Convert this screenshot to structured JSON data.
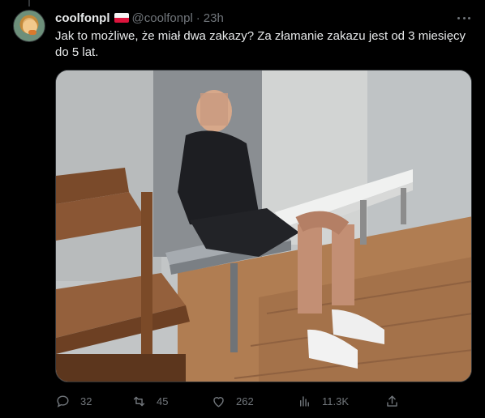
{
  "tweet": {
    "display_name": "coolfonpl",
    "flag": "Poland flag",
    "handle": "@coolfonpl",
    "separator": "·",
    "time": "23h",
    "text": "Jak to możliwe, że miał dwa zakazy? Za złamanie zakazu jest od 3 miesięcy do 5 lat."
  },
  "media": {
    "description_icon": "photo"
  },
  "actions": {
    "replies": "32",
    "reposts": "45",
    "likes": "262",
    "views": "11.3K"
  },
  "colors": {
    "background": "#000000",
    "text_primary": "#e7e9ea",
    "text_secondary": "#71767b",
    "border": "#2f3336"
  }
}
